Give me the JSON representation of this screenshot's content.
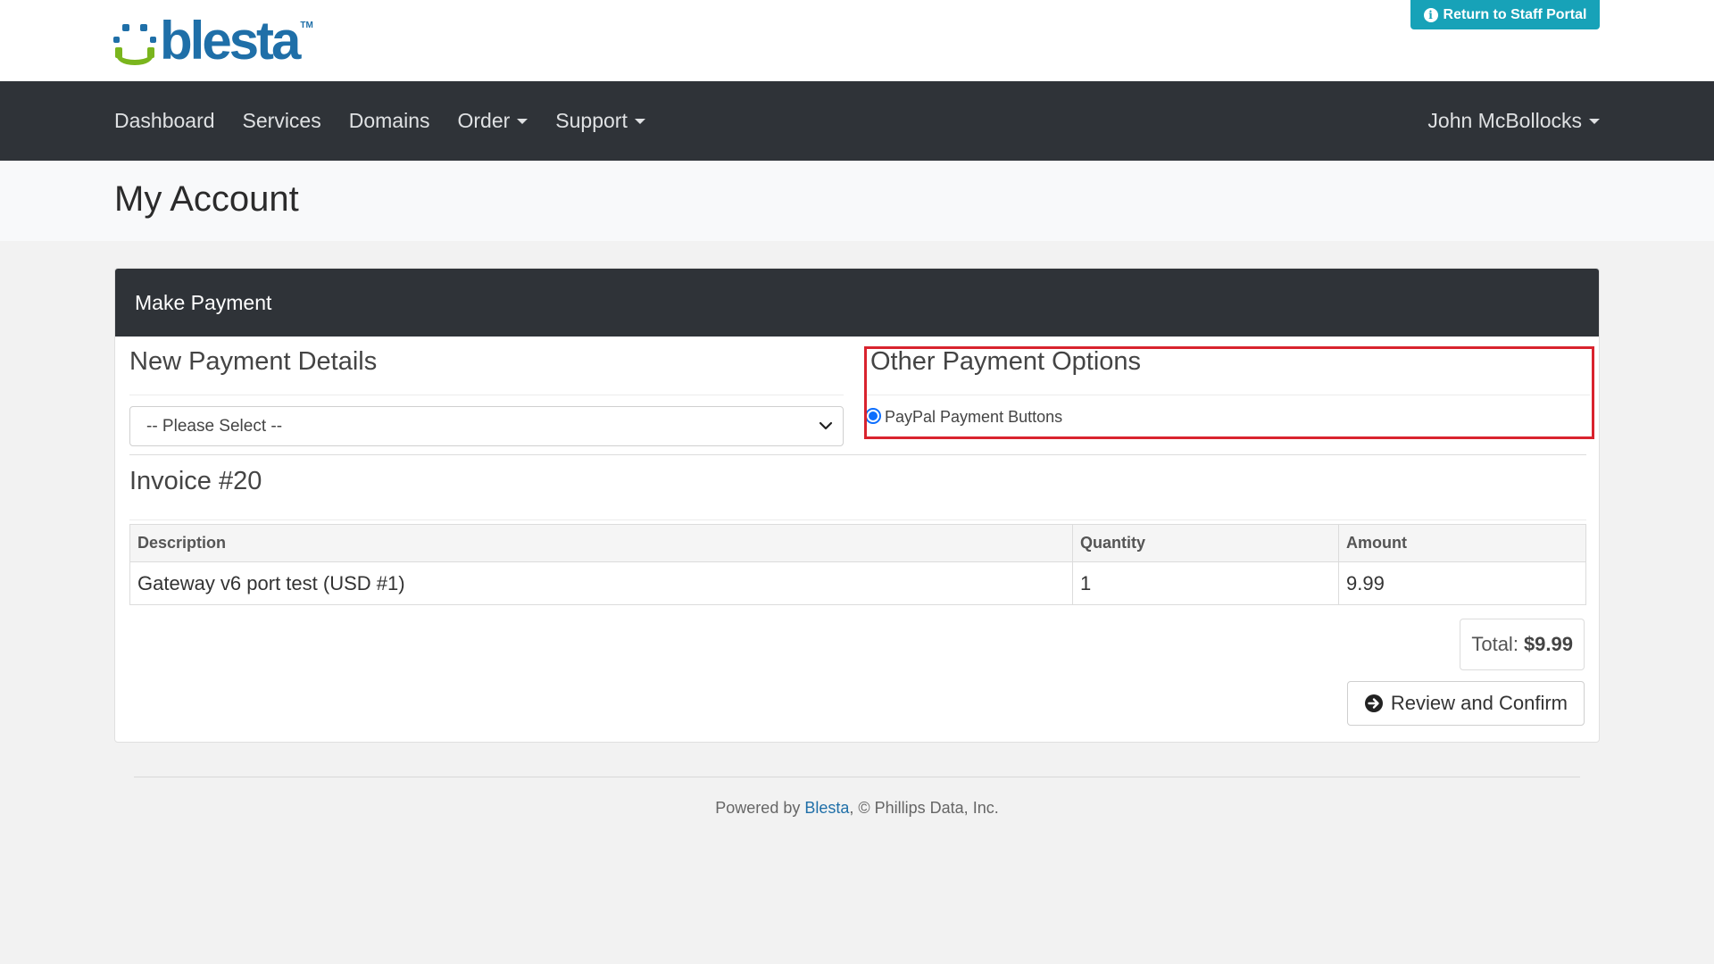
{
  "header": {
    "logo_text": "blesta",
    "logo_tm": "TM",
    "staff_button_label": "Return to Staff Portal"
  },
  "nav": {
    "items": [
      {
        "label": "Dashboard",
        "dropdown": false
      },
      {
        "label": "Services",
        "dropdown": false
      },
      {
        "label": "Domains",
        "dropdown": false
      },
      {
        "label": "Order",
        "dropdown": true
      },
      {
        "label": "Support",
        "dropdown": true
      }
    ],
    "user_label": "John McBollocks"
  },
  "page": {
    "title": "My Account"
  },
  "payment": {
    "card_title": "Make Payment",
    "new_details_title": "New Payment Details",
    "select_value": "-- Please Select --",
    "other_options_title": "Other Payment Options",
    "other_option_label": "PayPal Payment Buttons",
    "invoice_title": "Invoice #20",
    "table": {
      "headers": [
        "Description",
        "Quantity",
        "Amount"
      ],
      "rows": [
        [
          "Gateway v6 port test (USD #1)",
          "1",
          "9.99"
        ]
      ]
    },
    "total_label": "Total:",
    "total_value": "$9.99",
    "review_button_label": "Review and Confirm"
  },
  "footer": {
    "prefix": "Powered by ",
    "link_text": "Blesta",
    "suffix": ", © Phillips Data, Inc."
  },
  "colors": {
    "navbar": "#2f3338",
    "accent": "#17a2b8",
    "brand_blue": "#1f6fa8",
    "brand_green": "#7ab51d",
    "highlight": "#d9232e"
  }
}
